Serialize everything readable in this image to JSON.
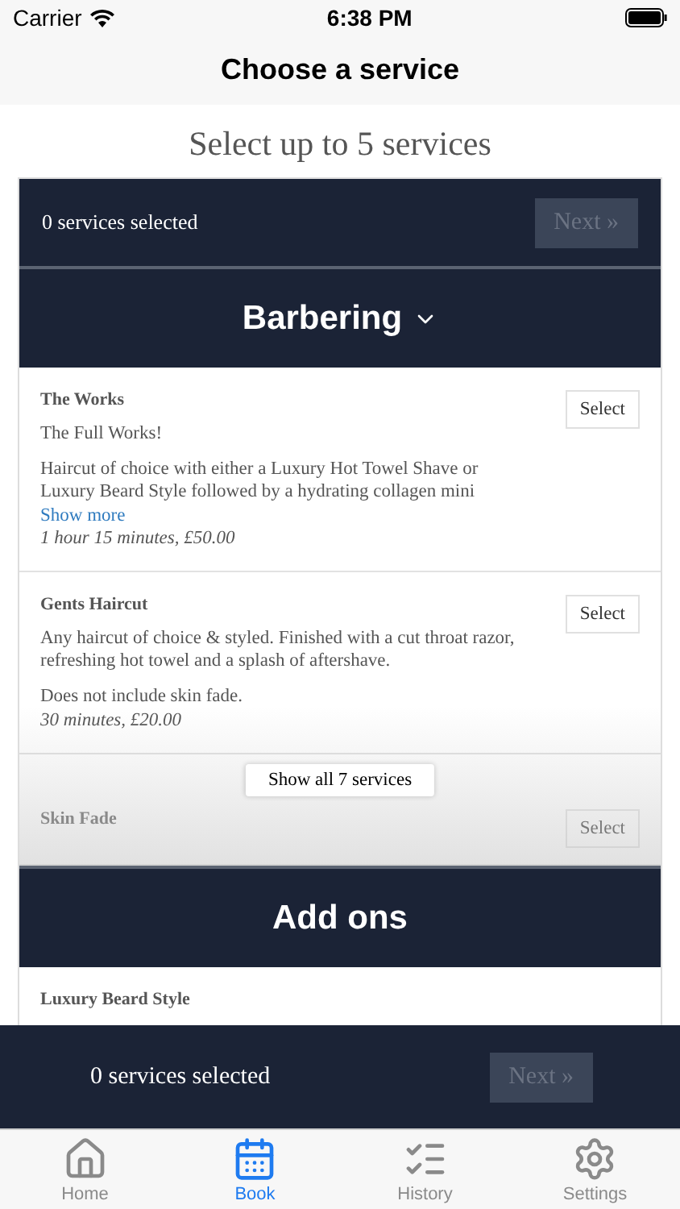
{
  "status_bar": {
    "carrier": "Carrier",
    "time": "6:38 PM"
  },
  "nav": {
    "title": "Choose a service"
  },
  "heading": "Select up to 5 services",
  "summary": {
    "count": "0 services selected",
    "next": "Next »",
    "disabled": true
  },
  "categories": [
    {
      "title": "Barbering",
      "kind": "dropdown",
      "services": [
        {
          "name": "The Works",
          "paragraphs": [
            "The Full Works!",
            "Haircut of choice with either a Luxury Hot Towel Shave or Luxury Beard Style followed by a hydrating collagen mini"
          ],
          "show_more": "Show more",
          "details": "1 hour 15 minutes, £50.00",
          "select": "Select",
          "faded": false
        },
        {
          "name": "Gents Haircut",
          "paragraphs": [
            "Any haircut of choice & styled. Finished with a cut throat razor, refreshing hot towel and a splash of aftershave.",
            "Does not include skin fade."
          ],
          "details": "30 minutes, £20.00",
          "select": "Select",
          "faded": false
        },
        {
          "name": "Skin Fade",
          "select": "Select",
          "faded": true
        }
      ],
      "show_all": "Show all 7 services"
    },
    {
      "title": "Add ons",
      "kind": "plain",
      "services": [
        {
          "name": "Luxury Beard Style",
          "faded": false
        }
      ]
    }
  ],
  "bottom_bar": {
    "count": "0 services selected",
    "next": "Next »",
    "disabled": true
  },
  "tabs": [
    {
      "label": "Home",
      "selected": false
    },
    {
      "label": "Book",
      "selected": true
    },
    {
      "label": "History",
      "selected": false
    },
    {
      "label": "Settings",
      "selected": false
    }
  ]
}
